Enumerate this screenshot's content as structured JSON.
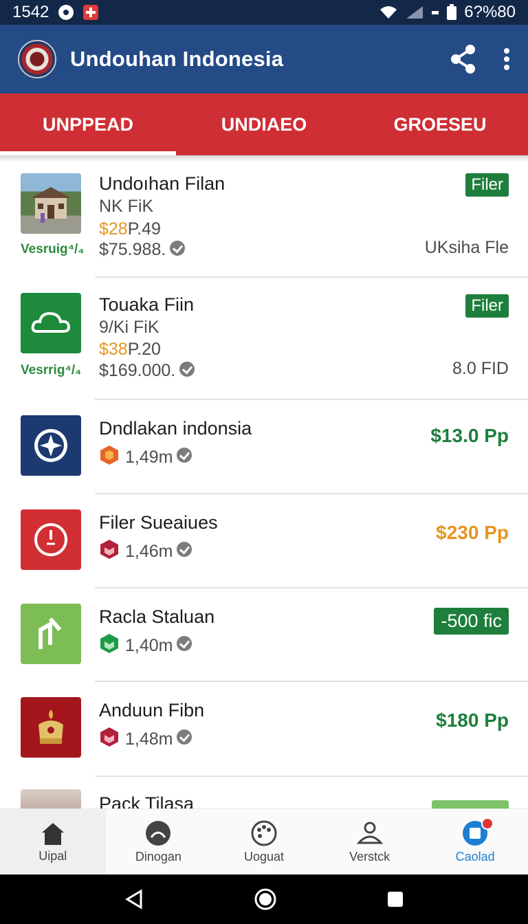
{
  "status_bar": {
    "time": "1542",
    "battery": "6?%80"
  },
  "app_bar": {
    "title": "Undouhan Indonesia"
  },
  "tabs": [
    {
      "label": "UNPPEAD"
    },
    {
      "label": "UNDIAEO"
    },
    {
      "label": "GROESEU"
    }
  ],
  "items": [
    {
      "title": "Undoıhan Filan",
      "line1": "NK FiK",
      "price_accent": "$28",
      "price_rest": "P.49",
      "amount": "$75.988.",
      "verify": "Vesruig⁴/₄",
      "badge": "Filer",
      "right_text": "UKsiha Fle"
    },
    {
      "title": "Touaka Fiin",
      "line1": "9/Ki FiK",
      "price_accent": "$38",
      "price_rest": "P.20",
      "amount": "$169.000.",
      "verify": "Vesrrig⁴/₄",
      "badge": "Filer",
      "right_text": "8.0 FID"
    },
    {
      "title": "Dndlakan indonsia",
      "count": "1,49m",
      "price": "$13.0 Pp",
      "price_color": "#1d7f3b"
    },
    {
      "title": "Filer Sueaiues",
      "count": "1,46m",
      "price": "$230 Pp",
      "price_color": "#e69520"
    },
    {
      "title": "Racla Staluan",
      "count": "1,40m",
      "badge": "-500 fic"
    },
    {
      "title": "Anduun Fibn",
      "count": "1,48m",
      "price": "$180 Pp",
      "price_color": "#1d7f3b"
    },
    {
      "title": "Pack Tilasa"
    }
  ],
  "bottom_nav": [
    {
      "label": "Uipal"
    },
    {
      "label": "Dinogan"
    },
    {
      "label": "Uoguat"
    },
    {
      "label": "Verstck"
    },
    {
      "label": "Caolad"
    }
  ],
  "colors": {
    "app_bar": "#244b86",
    "tabs": "#cf2f34",
    "accent_green": "#1d7f3b",
    "accent_orange": "#e69520",
    "nav_active": "#1d7fd3"
  }
}
